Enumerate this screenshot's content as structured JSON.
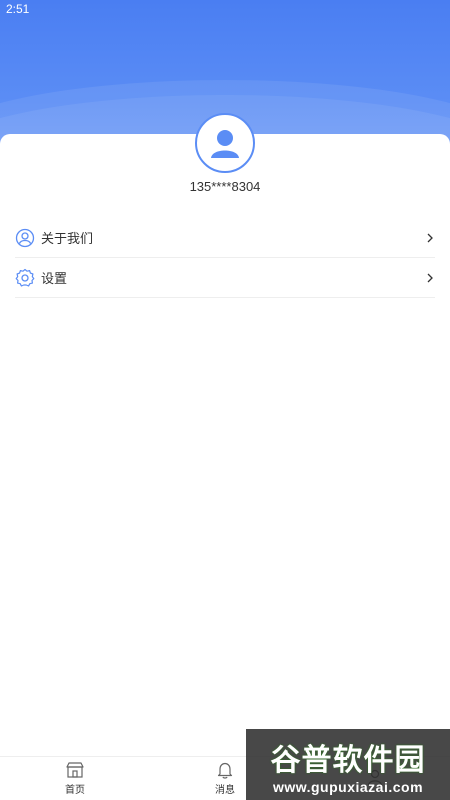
{
  "status_bar": {
    "time": "2:51"
  },
  "profile": {
    "phone": "135****8304"
  },
  "menu": {
    "items": [
      {
        "label": "关于我们",
        "icon": "user-circle-icon"
      },
      {
        "label": "设置",
        "icon": "gear-icon"
      }
    ]
  },
  "tabbar": {
    "tabs": [
      {
        "label": "首页",
        "icon": "store-icon"
      },
      {
        "label": "消息",
        "icon": "bell-icon"
      },
      {
        "label": "",
        "icon": "profile-icon"
      }
    ]
  },
  "watermark": {
    "text": "谷普软件园",
    "url": "www.gupuxiazai.com"
  },
  "colors": {
    "accent": "#5b8df5",
    "header_top": "#4a7ef2",
    "text": "#333333"
  }
}
